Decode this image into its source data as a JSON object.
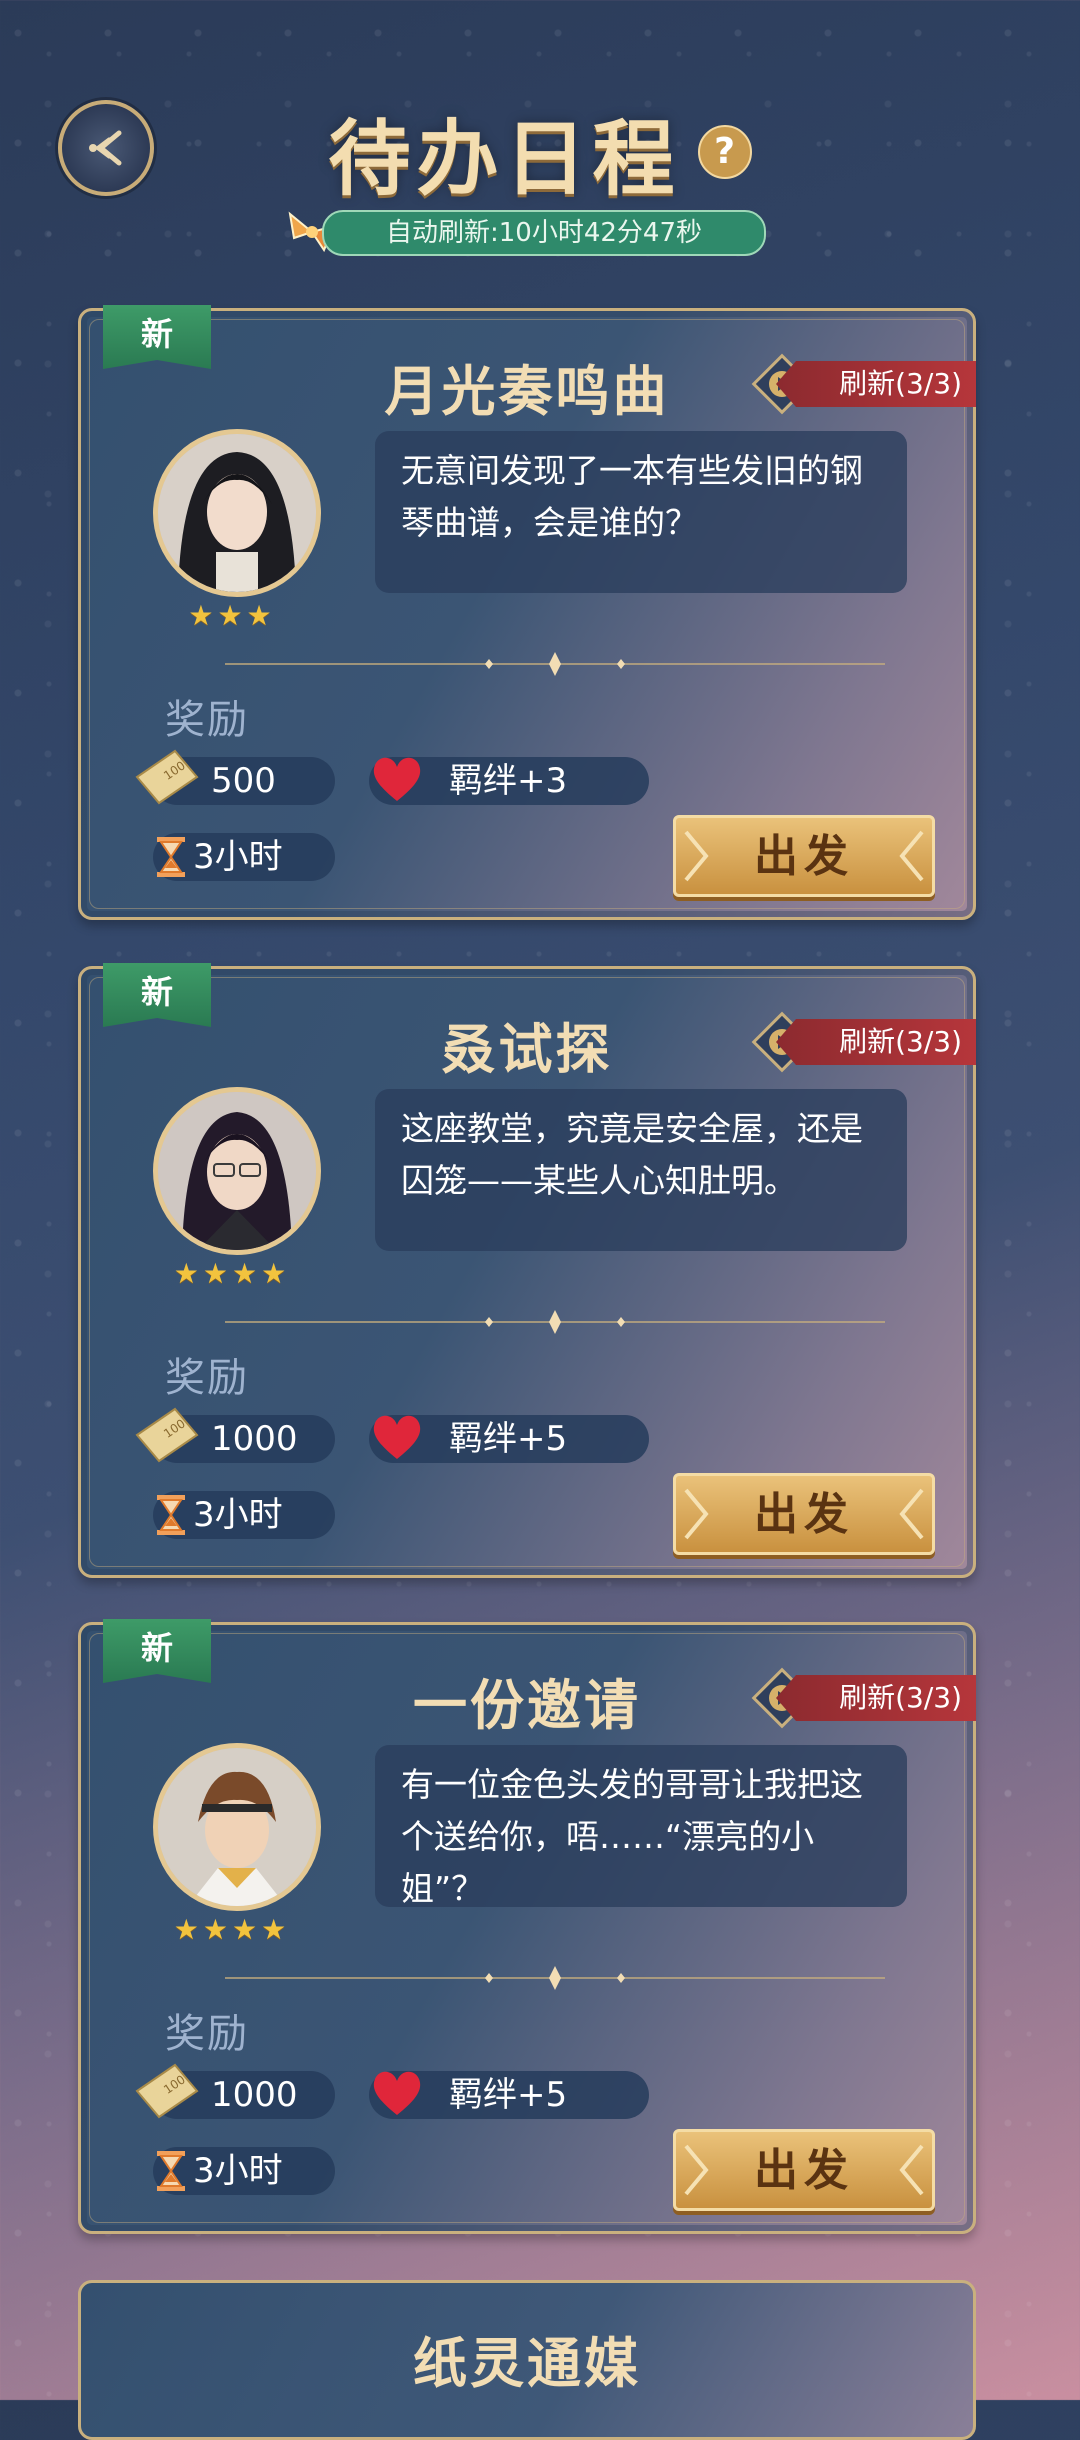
{
  "header": {
    "title": "待办日程",
    "help_symbol": "?",
    "auto_refresh": "自动刷新:10小时42分47秒"
  },
  "cards": [
    {
      "badge": "新",
      "title": "月光奏鸣曲",
      "refresh": "刷新(3/3)",
      "stars": "★★★",
      "description": "无意间发现了一本有些发旧的钢琴曲谱，会是谁的？",
      "reward_label": "奖励",
      "money": "500",
      "bond": "羁绊+3",
      "duration": "3小时",
      "go": "出发"
    },
    {
      "badge": "新",
      "title": "叒试探",
      "refresh": "刷新(3/3)",
      "stars": "★★★★",
      "description": "这座教堂，究竟是安全屋，还是囚笼——某些人心知肚明。",
      "reward_label": "奖励",
      "money": "1000",
      "bond": "羁绊+5",
      "duration": "3小时",
      "go": "出发"
    },
    {
      "badge": "新",
      "title": "一份邀请",
      "refresh": "刷新(3/3)",
      "stars": "★★★★",
      "description": "有一位金色头发的哥哥让我把这个送给你，唔……“漂亮的小姐”？",
      "reward_label": "奖励",
      "money": "1000",
      "bond": "羁绊+5",
      "duration": "3小时",
      "go": "出发"
    }
  ],
  "partial_card": {
    "title": "纸灵通媒"
  },
  "icons": {
    "back": "back-arrow-icon",
    "help": "question-icon",
    "bow": "bow-icon",
    "play": "play-icon",
    "money": "ticket-icon",
    "heart": "heart-icon",
    "time": "hourglass-icon"
  },
  "colors": {
    "title_gold": "#f3ddb0",
    "refresh_green": "#2f8a6b",
    "badge_green": "#3e9b68",
    "refresh_red": "#b6363b",
    "button_gold": "#d9a95b",
    "star_yellow": "#f2c33e"
  }
}
